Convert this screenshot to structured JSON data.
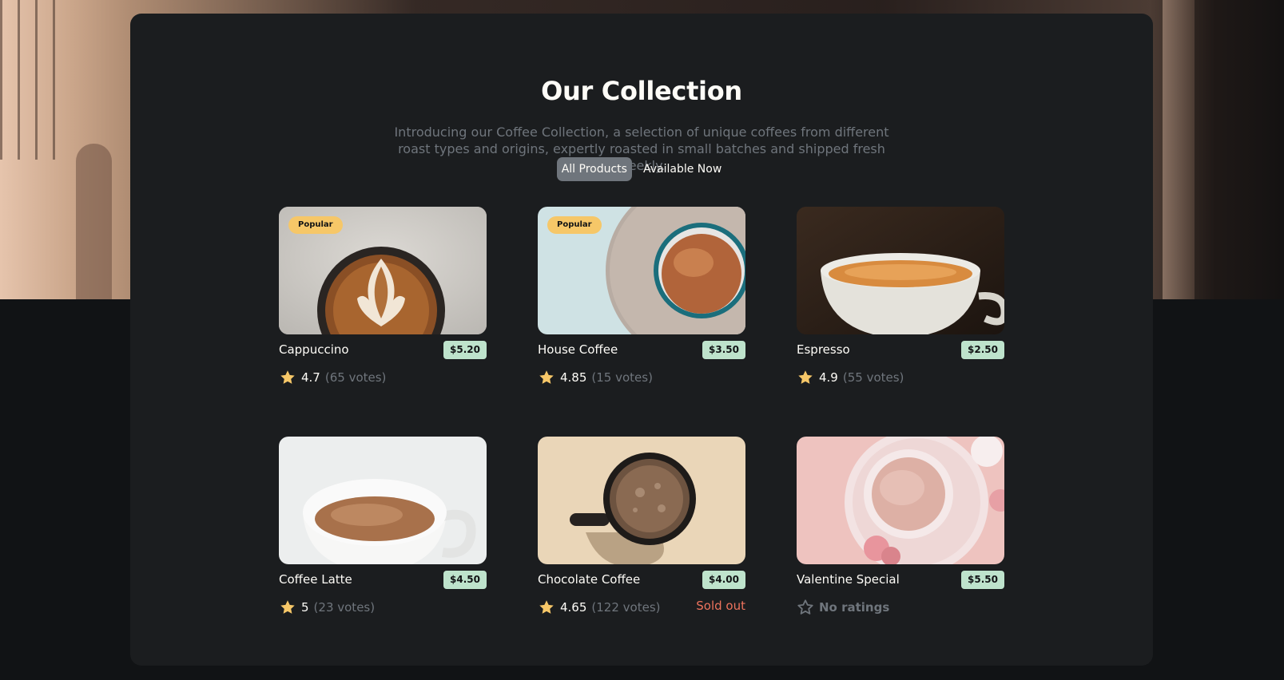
{
  "section": {
    "title": "Our Collection",
    "intro": "Introducing our Coffee Collection, a selection of unique coffees from different roast types and origins, expertly roasted in small batches and shipped fresh weekly."
  },
  "tabs": [
    {
      "label": "All Products",
      "active": true
    },
    {
      "label": "Available Now",
      "active": false
    }
  ],
  "products": [
    {
      "name": "Cappuccino",
      "price": "$5.20",
      "rating": "4.7",
      "votes": "(65 votes)",
      "badge": "Popular",
      "sold_out": "",
      "image": "cappuccino-latte-art-icon"
    },
    {
      "name": "House Coffee",
      "price": "$3.50",
      "rating": "4.85",
      "votes": "(15 votes)",
      "badge": "Popular",
      "sold_out": "",
      "image": "house-coffee-cup-icon"
    },
    {
      "name": "Espresso",
      "price": "$2.50",
      "rating": "4.9",
      "votes": "(55 votes)",
      "badge": "",
      "sold_out": "",
      "image": "espresso-cup-icon"
    },
    {
      "name": "Coffee Latte",
      "price": "$4.50",
      "rating": "5",
      "votes": "(23 votes)",
      "badge": "",
      "sold_out": "",
      "image": "latte-cup-icon"
    },
    {
      "name": "Chocolate Coffee",
      "price": "$4.00",
      "rating": "4.65",
      "votes": "(122 votes)",
      "badge": "",
      "sold_out": "Sold out",
      "image": "chocolate-coffee-mug-icon"
    },
    {
      "name": "Valentine Special",
      "price": "$5.50",
      "rating": "",
      "votes": "",
      "no_ratings": "No ratings",
      "badge": "",
      "sold_out": "",
      "image": "valentine-pink-latte-icon"
    }
  ],
  "colors": {
    "page_bg": "#111315",
    "panel_bg": "#1b1d1f",
    "text_primary": "#fefcf7",
    "text_muted": "#6f757c",
    "badge_bg": "#f6c768",
    "price_bg": "#bee3cc",
    "sold_out": "#ed735d",
    "star_fill": "#f6c768"
  }
}
